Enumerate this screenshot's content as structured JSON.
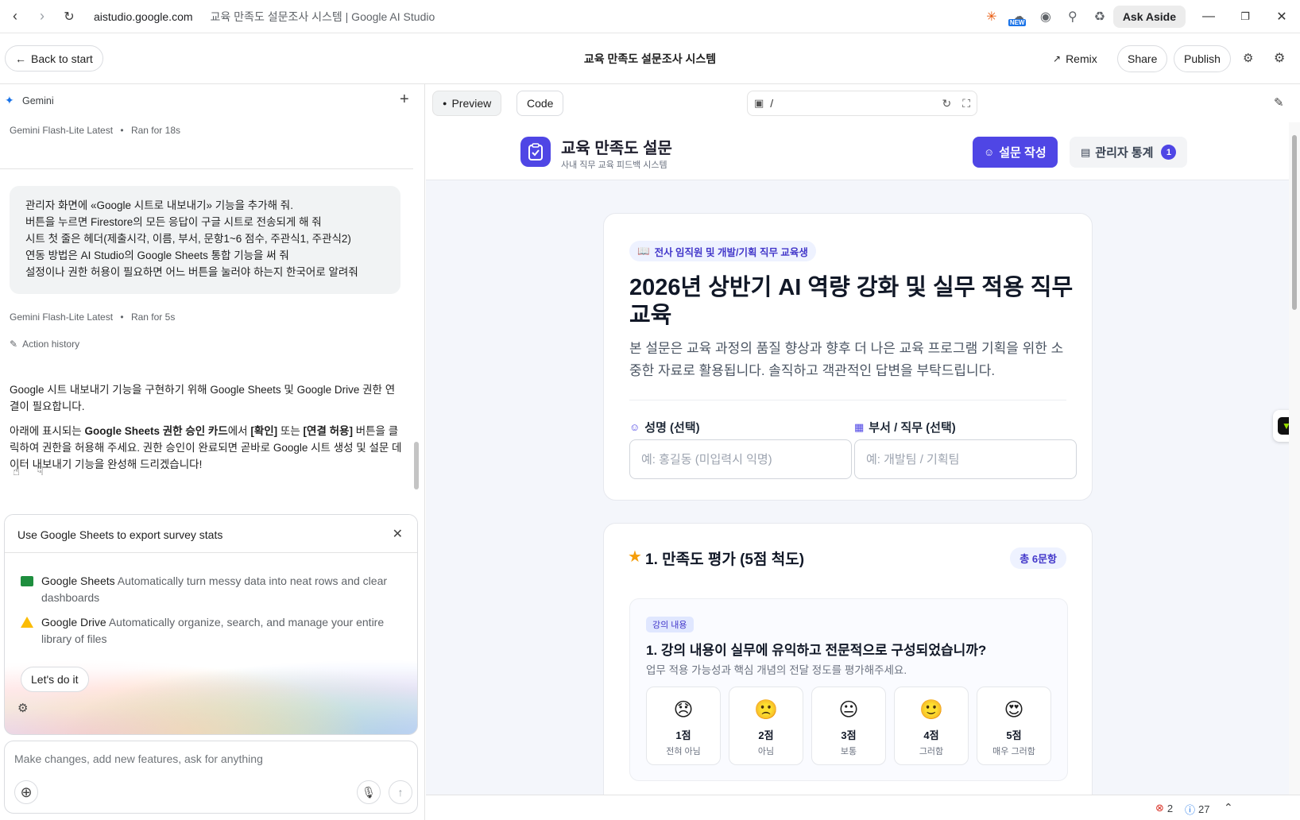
{
  "browser": {
    "url": "aistudio.google.com",
    "tab_title": "교육 만족도 설문조사 시스템 | Google AI Studio",
    "ask_aside": "Ask Aside",
    "new_badge": "NEW"
  },
  "app": {
    "back_label": "Back to start",
    "title": "교육 만족도 설문조사 시스템",
    "remix_label": "Remix",
    "share_label": "Share",
    "publish_label": "Publish"
  },
  "chat": {
    "gemini_label": "Gemini",
    "meta1_model": "Gemini Flash-Lite Latest",
    "meta1_time": "Ran for 18s",
    "user_message_lines": [
      "관리자 화면에 «Google 시트로 내보내기» 기능을 추가해 줘.",
      "버튼을 누르면 Firestore의 모든 응답이 구글 시트로 전송되게 해 줘",
      "시트 첫 줄은 헤더(제출시각, 이름, 부서, 문항1~6 점수, 주관식1, 주관식2)",
      "연동 방법은 AI Studio의 Google Sheets 통합 기능을 써 줘",
      "설정이나 권한 허용이 필요하면 어느 버튼을 눌러야 하는지 한국어로 알려줘"
    ],
    "meta2_model": "Gemini Flash-Lite Latest",
    "meta2_time": "Ran for 5s",
    "action_history": "Action history",
    "reply_p1": "Google 시트 내보내기 기능을 구현하기 위해 Google Sheets 및 Google Drive 권한 연결이 필요합니다.",
    "reply_p2_a": "아래에 표시되는 ",
    "reply_p2_b": "Google Sheets 권한 승인 카드",
    "reply_p2_c": "에서 ",
    "reply_p2_d": "[확인]",
    "reply_p2_e": " 또는 ",
    "reply_p2_f": "[연결 허용]",
    "reply_p2_g": " 버튼을 클릭하여 권한을 허용해 주세요. 권한 승인이 완료되면 곧바로 Google 시트 생성 및 설문 데이터 내보내기 기능을 완성해 드리겠습니다!"
  },
  "integration_card": {
    "title": "Use Google Sheets to export survey stats",
    "sheets_name": "Google Sheets",
    "sheets_desc": "Automatically turn messy data into neat rows and clear dashboards",
    "drive_name": "Google Drive",
    "drive_desc": "Automatically organize, search, and manage your entire library of files",
    "action_label": "Let's do it"
  },
  "prompt": {
    "placeholder": "Make changes, add new features, ask for anything"
  },
  "preview_toolbar": {
    "preview_label": "Preview",
    "code_label": "Code",
    "path": "/"
  },
  "site": {
    "title": "교육 만족도 설문",
    "subtitle": "사내 직무 교육 피드백 시스템",
    "nav_survey": "설문 작성",
    "nav_admin": "관리자 통계",
    "admin_badge": "1",
    "tag": "전사 임직원 및 개발/기획 직무 교육생",
    "survey_title": "2026년 상반기 AI 역량 강화 및 실무 적용 직무 교육",
    "survey_desc": "본 설문은 교육 과정의 품질 향상과 향후 더 나은 교육 프로그램 기획을 위한 소중한 자료로 활용됩니다. 솔직하고 객관적인 답변을 부탁드립니다.",
    "name_label": "성명 (선택)",
    "name_placeholder": "예: 홍길동 (미입력시 익명)",
    "dept_label": "부서 / 직무 (선택)",
    "dept_placeholder": "예: 개발팀 / 기획팀",
    "rating_title": "1. 만족도 평가 (5점 척도)",
    "rating_count": "총 6문항",
    "q1_chip": "강의 내용",
    "q1_title": "1. 강의 내용이 실무에 유익하고 전문적으로 구성되었습니까?",
    "q1_sub": "업무 적용 가능성과 핵심 개념의 전달 정도를 평가해주세요.",
    "options": [
      {
        "emoji": "😞",
        "score": "1점",
        "label": "전혀 아님"
      },
      {
        "emoji": "🙁",
        "score": "2점",
        "label": "아님"
      },
      {
        "emoji": "😐",
        "score": "3점",
        "label": "보통"
      },
      {
        "emoji": "🙂",
        "score": "4점",
        "label": "그러함"
      },
      {
        "emoji": "😍",
        "score": "5점",
        "label": "매우 그러함"
      }
    ]
  },
  "status": {
    "errors": "2",
    "info": "27"
  },
  "colors": {
    "accent": "#4f46e5",
    "page_bg": "#f4f6fb"
  }
}
